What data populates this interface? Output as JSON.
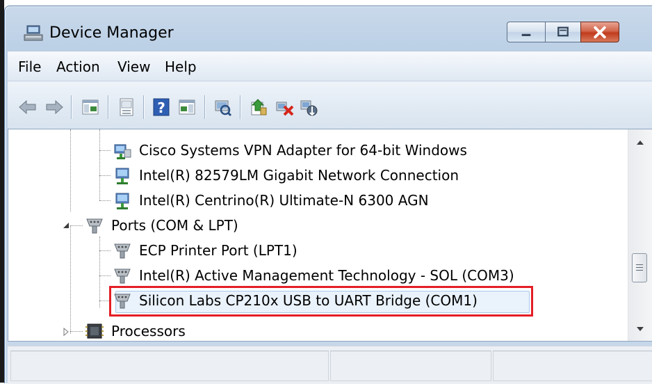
{
  "window": {
    "title": "Device Manager"
  },
  "menu": [
    {
      "label": "File"
    },
    {
      "label": "Action"
    },
    {
      "label": "View"
    },
    {
      "label": "Help"
    }
  ],
  "toolbar": {
    "buttons": [
      "back-arrow",
      "forward-arrow",
      "show-hide-console-tree",
      "properties",
      "help",
      "action-pane",
      "scan-hardware",
      "update-driver",
      "uninstall-device",
      "disable-device"
    ]
  },
  "tree": {
    "rows": [
      {
        "label": "Cisco Systems VPN Adapter for 64-bit Windows",
        "icon": "network-adapter-icon"
      },
      {
        "label": "Intel(R) 82579LM Gigabit Network Connection",
        "icon": "network-adapter-icon"
      },
      {
        "label": "Intel(R) Centrino(R) Ultimate-N 6300 AGN",
        "icon": "network-adapter-icon"
      },
      {
        "label": "Ports (COM & LPT)",
        "icon": "port-icon",
        "expanded": true
      },
      {
        "label": "ECP Printer Port (LPT1)",
        "icon": "port-icon"
      },
      {
        "label": "Intel(R) Active Management Technology - SOL (COM3)",
        "icon": "port-icon"
      },
      {
        "label": "Silicon Labs CP210x USB to UART Bridge (COM1)",
        "icon": "port-icon",
        "highlighted": true
      },
      {
        "label": "Processors",
        "icon": "processor-icon",
        "expanded": false
      }
    ]
  },
  "colors": {
    "highlight_box": "#e41e26",
    "close_button": "#c13b1d"
  }
}
